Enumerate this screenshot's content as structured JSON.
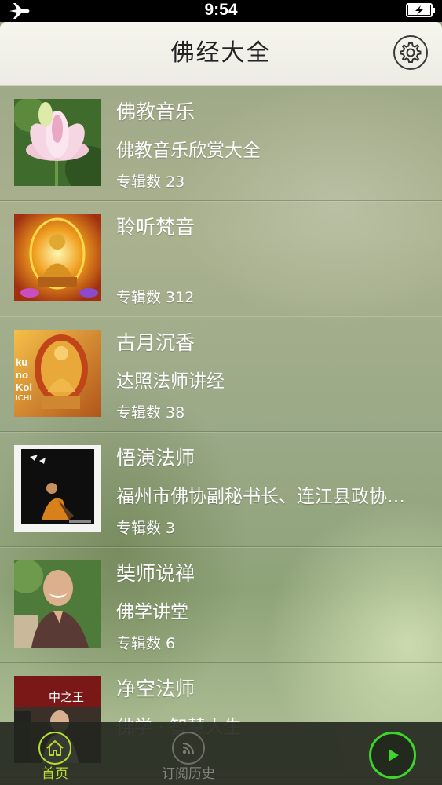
{
  "status_bar": {
    "time": "9:54"
  },
  "nav": {
    "title": "佛经大全"
  },
  "list": {
    "items": [
      {
        "title": "佛教音乐",
        "subtitle": "佛教音乐欣赏大全",
        "count": "专辑数 23",
        "icon": "lotus-thumbnail"
      },
      {
        "title": "聆听梵音",
        "subtitle": "",
        "count": "专辑数 312",
        "icon": "buddha-thumbnail"
      },
      {
        "title": "古月沉香",
        "subtitle": "达照法师讲经",
        "count": "专辑数 38",
        "icon": "golden-buddha-thumbnail",
        "thumb_text": "ku\nno\nKoi\nICHI"
      },
      {
        "title": "悟演法师",
        "subtitle": "福州市佛协副秘书长、连江县政协…",
        "count": "专辑数 3",
        "icon": "monk-photo-thumbnail"
      },
      {
        "title": "奘师说禅",
        "subtitle": "佛学讲堂",
        "count": "专辑数 6",
        "icon": "smiling-monk-thumbnail"
      },
      {
        "title": "净空法师",
        "subtitle": "佛学 · 智慧人生",
        "count": "",
        "icon": "master-thumbnail",
        "thumb_text": "中之王"
      }
    ]
  },
  "tab_bar": {
    "home_label": "首页",
    "history_label": "订阅历史"
  },
  "colors": {
    "active_tab": "#b6dc2e",
    "play_button": "#3fd42a"
  }
}
